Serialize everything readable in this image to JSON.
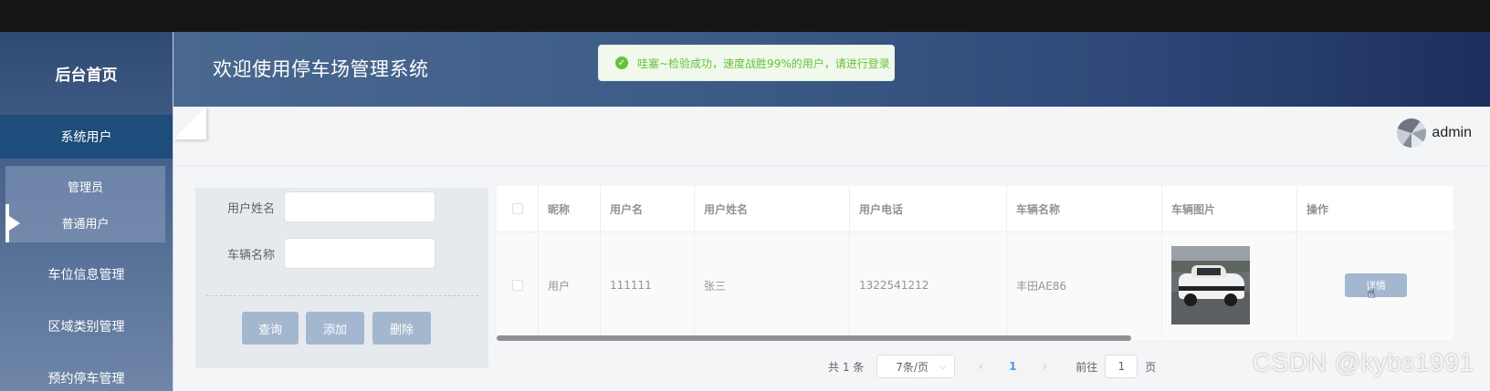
{
  "sidebar": {
    "title": "后台首页",
    "items": [
      {
        "label": "系统用户",
        "active": true
      },
      {
        "label": "车位信息管理"
      },
      {
        "label": "区域类别管理"
      },
      {
        "label": "预约停车管理"
      }
    ],
    "sub_items": [
      {
        "label": "管理员"
      },
      {
        "label": "普通用户",
        "selected": true
      }
    ]
  },
  "header": {
    "title": "欢迎使用停车场管理系统"
  },
  "toast": {
    "icon": "check-circle-icon",
    "message": "哇塞~检验成功，速度战胜99%的用户，请进行登录",
    "color": "#67c23a"
  },
  "user": {
    "name": "admin"
  },
  "search": {
    "fields": [
      {
        "label": "用户姓名",
        "value": ""
      },
      {
        "label": "车辆名称",
        "value": ""
      }
    ],
    "buttons": {
      "query": "查询",
      "add": "添加",
      "delete": "删除"
    }
  },
  "table": {
    "columns": [
      "",
      "昵称",
      "用户名",
      "用户姓名",
      "用户电话",
      "车辆名称",
      "车辆图片",
      "操作"
    ],
    "rows": [
      {
        "nickname": "用户",
        "username": "111111",
        "realname": "张三",
        "phone": "1322541212",
        "vehicle_name": "丰田AE86",
        "vehicle_image": "car-photo",
        "action_label": "详情"
      }
    ]
  },
  "pagination": {
    "total_text": "共 1 条",
    "page_size": "7条/页",
    "current_page": "1",
    "goto_label": "前往",
    "goto_value": "1",
    "page_suffix": "页"
  },
  "watermark": "CSDN @kybs1991",
  "colors": {
    "accent_button": "#a3b7cf",
    "header_dark": "#1c2f5e",
    "sidebar_active": "#1f4d7b"
  }
}
